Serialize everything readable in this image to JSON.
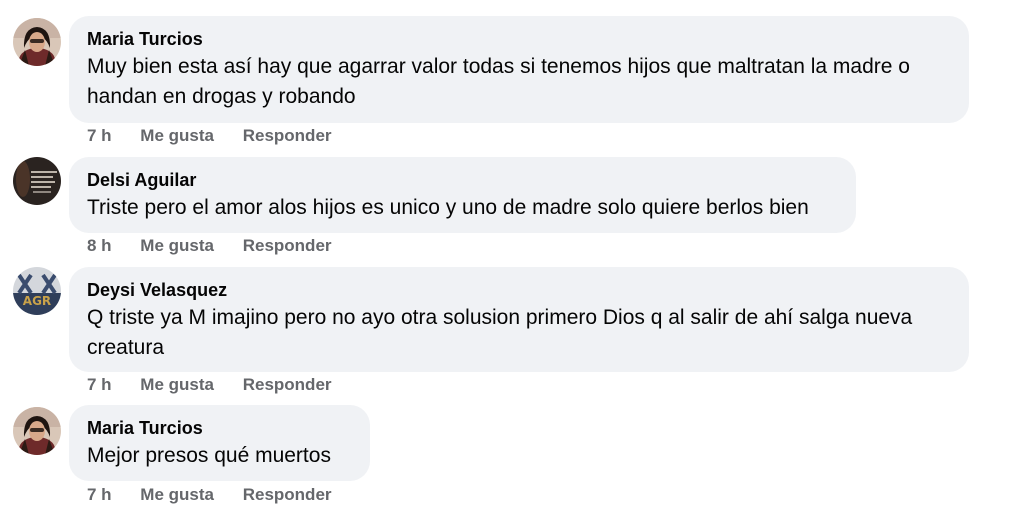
{
  "comments": [
    {
      "author": "Maria Turcios",
      "text": "Muy bien esta así hay que agarrar valor todas si tenemos hijos que maltratan la madre o handan en drogas y robando",
      "time": "7 h",
      "like": "Me gusta",
      "reply": "Responder"
    },
    {
      "author": "Delsi Aguilar",
      "text": "Triste pero el amor alos hijos es unico y uno de madre solo quiere berlos bien",
      "time": "8 h",
      "like": "Me gusta",
      "reply": "Responder"
    },
    {
      "author": "Deysi Velasquez",
      "text": "Q triste ya M imajino pero no ayo otra solusion primero Dios q al salir de ahí salga nueva creatura",
      "time": "7 h",
      "like": "Me gusta",
      "reply": "Responder"
    },
    {
      "author": "Maria Turcios",
      "text": "Mejor presos qué muertos",
      "time": "7 h",
      "like": "Me gusta",
      "reply": "Responder"
    }
  ]
}
